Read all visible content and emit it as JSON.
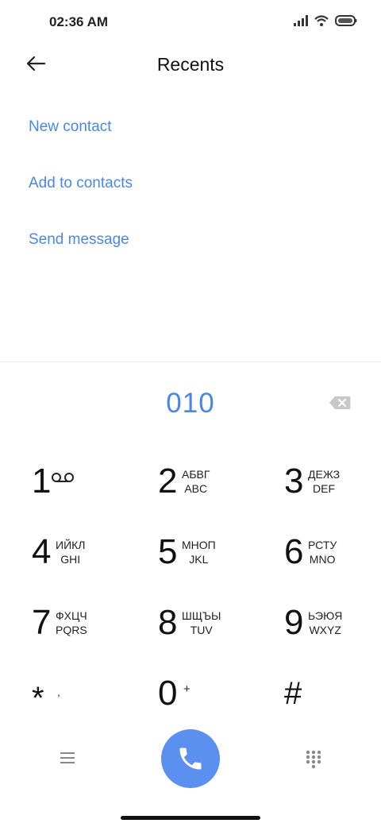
{
  "status_bar": {
    "time": "02:36 AM"
  },
  "header": {
    "title": "Recents"
  },
  "actions": {
    "new_contact": "New contact",
    "add_to_contacts": "Add to contacts",
    "send_message": "Send message"
  },
  "dialer": {
    "number": "010"
  },
  "keys": [
    {
      "digit": "1",
      "letters_ru": "",
      "letters_en": ""
    },
    {
      "digit": "2",
      "letters_ru": "АБВГ",
      "letters_en": "ABC"
    },
    {
      "digit": "3",
      "letters_ru": "ДЕЖЗ",
      "letters_en": "DEF"
    },
    {
      "digit": "4",
      "letters_ru": "ИЙКЛ",
      "letters_en": "GHI"
    },
    {
      "digit": "5",
      "letters_ru": "МНОП",
      "letters_en": "JKL"
    },
    {
      "digit": "6",
      "letters_ru": "РСТУ",
      "letters_en": "MNO"
    },
    {
      "digit": "7",
      "letters_ru": "ФХЦЧ",
      "letters_en": "PQRS"
    },
    {
      "digit": "8",
      "letters_ru": "ШЩЪЫ",
      "letters_en": "TUV"
    },
    {
      "digit": "9",
      "letters_ru": "ЬЭЮЯ",
      "letters_en": "WXYZ"
    },
    {
      "digit": "*",
      "letters_ru": ",",
      "letters_en": ""
    },
    {
      "digit": "0",
      "letters_ru": "+",
      "letters_en": ""
    },
    {
      "digit": "#",
      "letters_ru": "",
      "letters_en": ""
    }
  ],
  "colors": {
    "accent": "#4b86e6",
    "call_button": "#5b8ff0"
  },
  "icons": {
    "back": "arrow-left-icon",
    "backspace": "backspace-icon",
    "voicemail": "voicemail-icon",
    "menu": "menu-icon",
    "call": "phone-icon",
    "keypad": "dialpad-icon"
  }
}
